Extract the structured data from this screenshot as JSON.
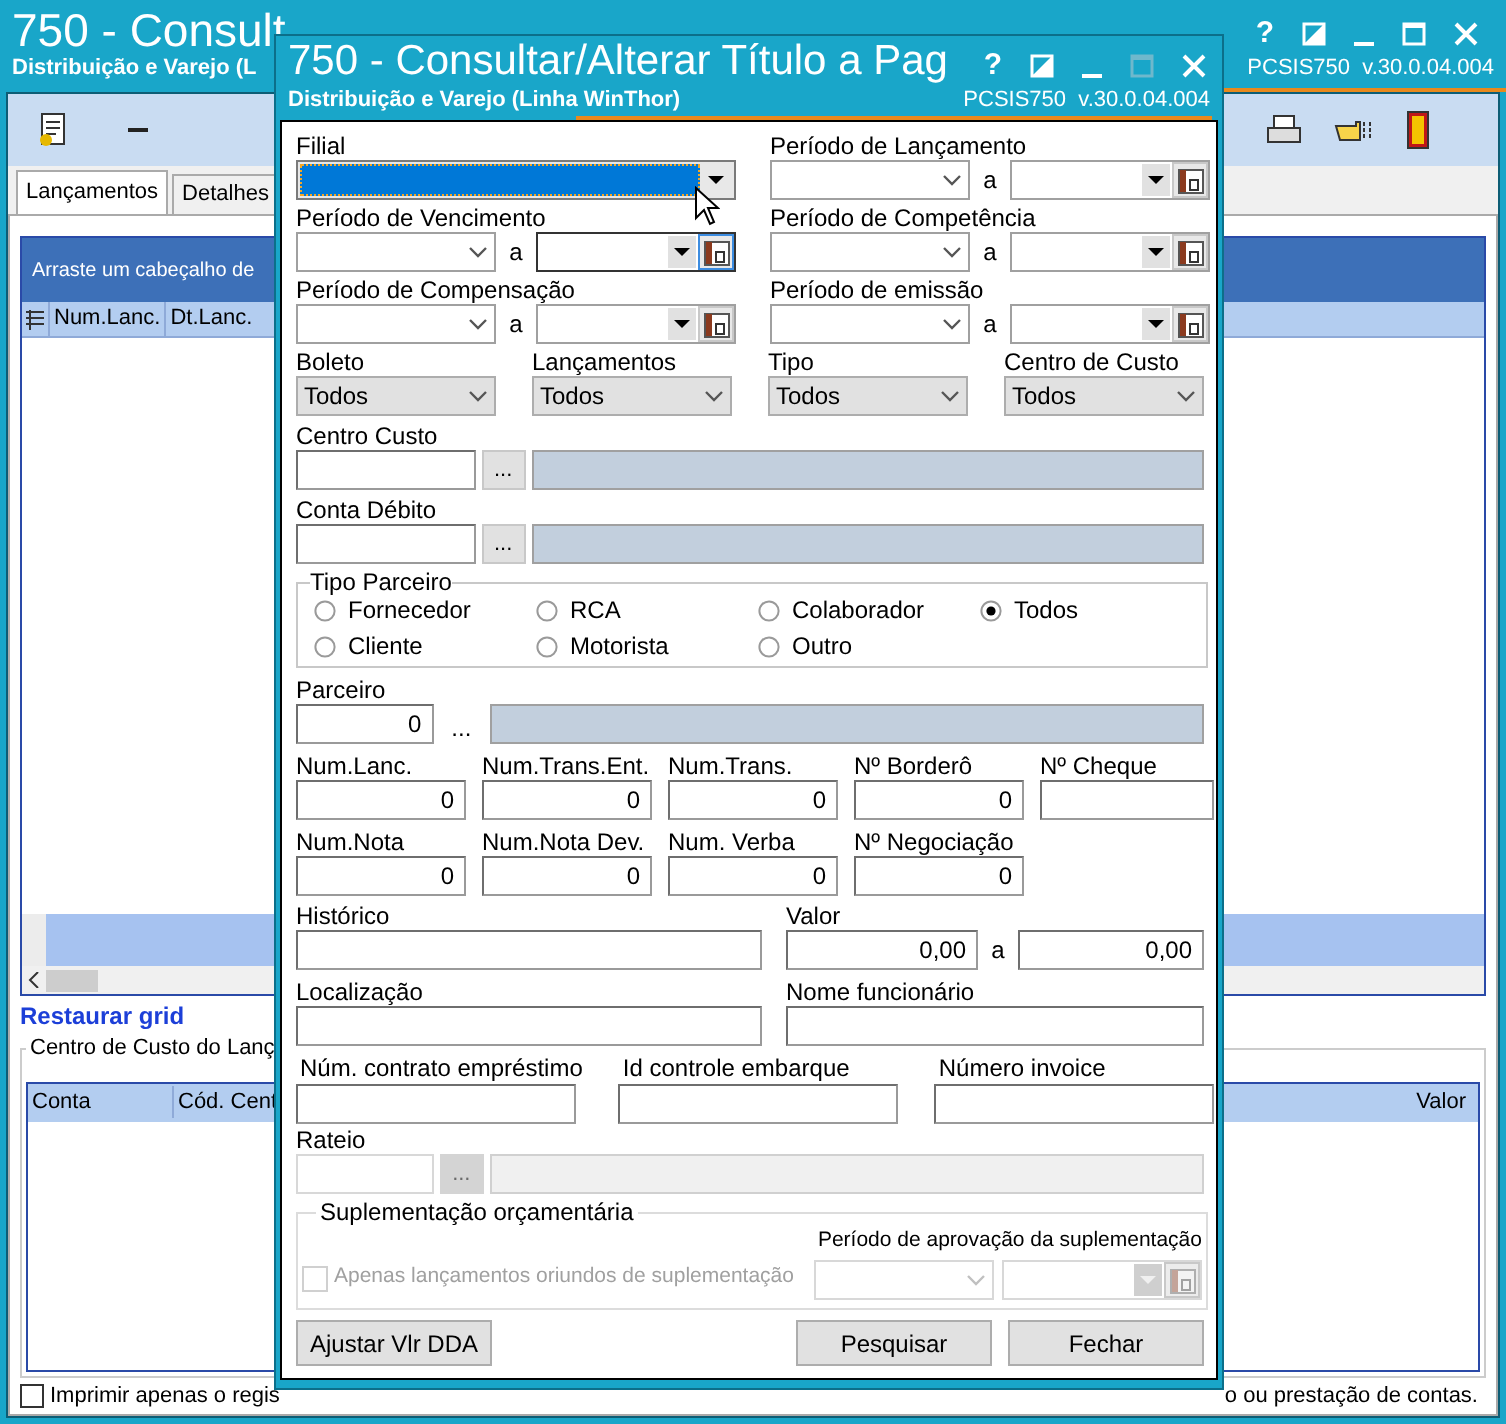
{
  "main_window": {
    "title": "750 - Consult",
    "subtitle": "Distribuição e Varejo (L",
    "program": "PCSIS750",
    "version": "v.30.0.04.004",
    "help": "?",
    "maximize_enabled": true,
    "tabs": [
      {
        "label": "Lançamentos",
        "selected": true
      },
      {
        "label": "Detalhes",
        "selected": false
      }
    ],
    "grid": {
      "group_hint": "Arraste um cabeçalho de",
      "columns": [
        "Num.Lanc.",
        "Dt.Lanc."
      ]
    },
    "restore_link": "Restaurar grid",
    "cost_center": {
      "title": "Centro de Custo do Lanç",
      "columns": [
        "Conta",
        "Cód. Cent"
      ],
      "last_column": "Valor"
    },
    "print_option": {
      "label_left": "Imprimir apenas o regis",
      "label_right": "o ou prestação de contas.",
      "checked": false
    }
  },
  "dialog": {
    "title": "750 - Consultar/Alterar Título a Pag",
    "subtitle": "Distribuição e Varejo (Linha WinThor)",
    "program": "PCSIS750",
    "version": "v.30.0.04.004",
    "help": "?",
    "maximize_enabled": false,
    "filial": {
      "label": "Filial",
      "focused": true
    },
    "date_ranges": [
      {
        "label": "Período de Lançamento",
        "separator": "a",
        "focused": false
      },
      {
        "label": "Período de Vencimento",
        "separator": "a",
        "focused": true
      },
      {
        "label": "Período de Competência",
        "separator": "a",
        "focused": false
      },
      {
        "label": "Período de Compensação",
        "separator": "a",
        "focused": false
      },
      {
        "label": "Período de emissão",
        "separator": "a",
        "focused": false
      }
    ],
    "selects": [
      {
        "label": "Boleto",
        "value": "Todos"
      },
      {
        "label": "Lançamentos",
        "value": "Todos"
      },
      {
        "label": "Tipo",
        "value": "Todos"
      },
      {
        "label": "Centro de Custo",
        "value": "Todos"
      }
    ],
    "lookups": [
      {
        "label": "Centro Custo",
        "button": "..."
      },
      {
        "label": "Conta Débito",
        "button": "..."
      }
    ],
    "tipo_parceiro": {
      "title": "Tipo Parceiro",
      "options": [
        {
          "label": "Fornecedor",
          "selected": false
        },
        {
          "label": "RCA",
          "selected": false
        },
        {
          "label": "Colaborador",
          "selected": false
        },
        {
          "label": "Todos",
          "selected": true
        },
        {
          "label": "Cliente",
          "selected": false
        },
        {
          "label": "Motorista",
          "selected": false
        },
        {
          "label": "Outro",
          "selected": false
        }
      ]
    },
    "parceiro": {
      "label": "Parceiro",
      "value": "0",
      "button": "..."
    },
    "number_rows": [
      [
        {
          "label": "Num.Lanc.",
          "value": "0"
        },
        {
          "label": "Num.Trans.Ent.",
          "value": "0"
        },
        {
          "label": "Num.Trans.",
          "value": "0"
        },
        {
          "label": "Nº Borderô",
          "value": "0"
        },
        {
          "label": "Nº Cheque"
        }
      ],
      [
        {
          "label": "Num.Nota",
          "value": "0"
        },
        {
          "label": "Num.Nota Dev.",
          "value": "0"
        },
        {
          "label": "Num. Verba",
          "value": "0"
        },
        {
          "label": "Nº Negociação",
          "value": "0"
        }
      ]
    ],
    "historico": {
      "label": "Histórico"
    },
    "valor": {
      "label": "Valor",
      "from": "0,00",
      "separator": "a",
      "to": "0,00"
    },
    "localizacao": {
      "label": "Localização"
    },
    "nome_funcionario": {
      "label": "Nome funcionário"
    },
    "extra_fields": [
      {
        "label": "Núm. contrato empréstimo"
      },
      {
        "label": "Id controle embarque"
      },
      {
        "label": "Número invoice"
      }
    ],
    "rateio": {
      "label": "Rateio",
      "button": "...",
      "disabled": true
    },
    "suplementacao": {
      "title": "Suplementação orçamentária",
      "checkbox": {
        "label": "Apenas lançamentos oriundos de suplementação",
        "checked": false,
        "disabled": true
      },
      "period_label": "Período de aprovação da suplementação"
    },
    "buttons": [
      {
        "label": "Ajustar Vlr DDA"
      },
      {
        "label": "Pesquisar"
      },
      {
        "label": "Fechar"
      }
    ]
  }
}
